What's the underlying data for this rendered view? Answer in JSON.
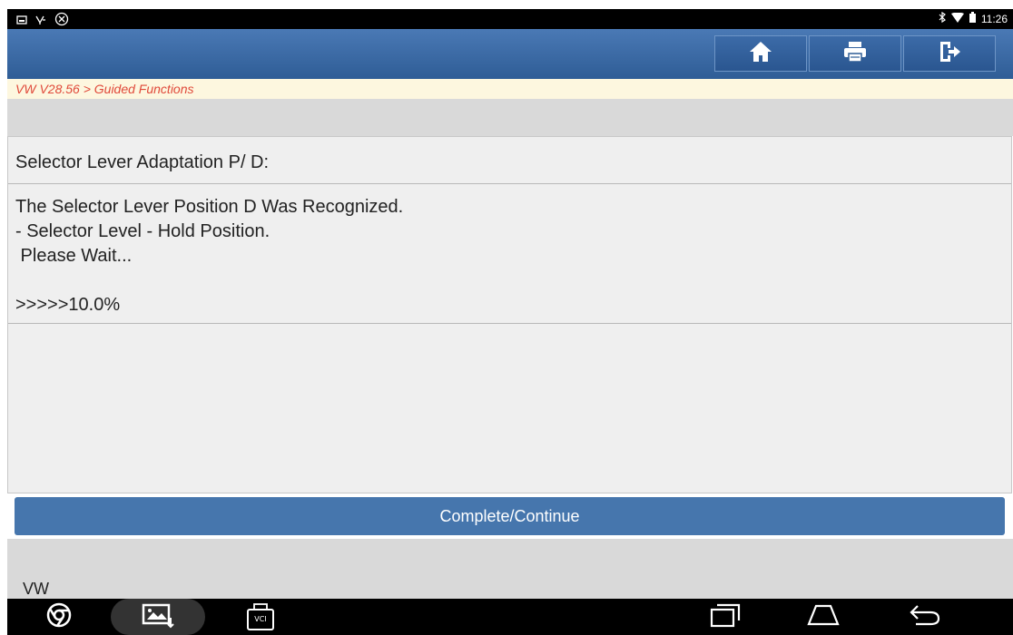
{
  "status_bar": {
    "time": "11:26"
  },
  "breadcrumb": "VW V28.56 > Guided Functions",
  "panel": {
    "title": "Selector Lever Adaptation P/ D:",
    "lines": [
      "The Selector Lever Position D Was Recognized.",
      "- Selector Level - Hold Position.",
      " Please Wait...",
      ">>>>>10.0%"
    ],
    "progress_percent": 10.0
  },
  "continue_button": "Complete/Continue",
  "footer_label": "VW",
  "nav": {
    "vci_label": "VCI"
  },
  "colors": {
    "header": "#3a68a4",
    "button": "#4676ad",
    "breadcrumb_text": "#e0493a"
  }
}
